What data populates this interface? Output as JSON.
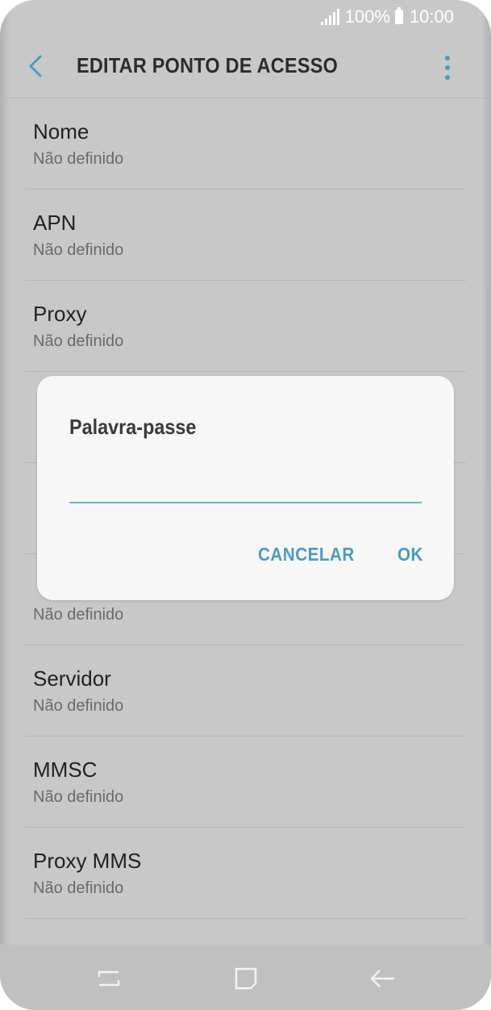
{
  "status_bar": {
    "battery_percent": "100%",
    "time": "10:00",
    "icons": [
      "signal-icon",
      "battery-icon"
    ]
  },
  "app_bar": {
    "title": "EDITAR PONTO DE ACESSO",
    "back_icon": "chevron-left-icon",
    "menu_icon": "more-vert-icon"
  },
  "settings": [
    {
      "label": "Nome",
      "value": "Não definido"
    },
    {
      "label": "APN",
      "value": "Não definido"
    },
    {
      "label": "Proxy",
      "value": "Não definido"
    },
    {
      "label": "",
      "value": ""
    },
    {
      "label": "",
      "value": ""
    },
    {
      "label": "",
      "value": "Não definido"
    },
    {
      "label": "Servidor",
      "value": "Não definido"
    },
    {
      "label": "MMSC",
      "value": "Não definido"
    },
    {
      "label": "Proxy MMS",
      "value": "Não definido"
    }
  ],
  "dialog": {
    "title": "Palavra-passe",
    "input_value": "",
    "cancel_label": "CANCELAR",
    "ok_label": "OK"
  },
  "nav_bar": {
    "icons": [
      "recents-icon",
      "home-icon",
      "back-icon"
    ]
  },
  "colors": {
    "accent": "#4a9cbd",
    "input_underline": "#6fb3cc",
    "dim_background": "#c8c8c8",
    "dialog_background": "#f7f7f7"
  }
}
